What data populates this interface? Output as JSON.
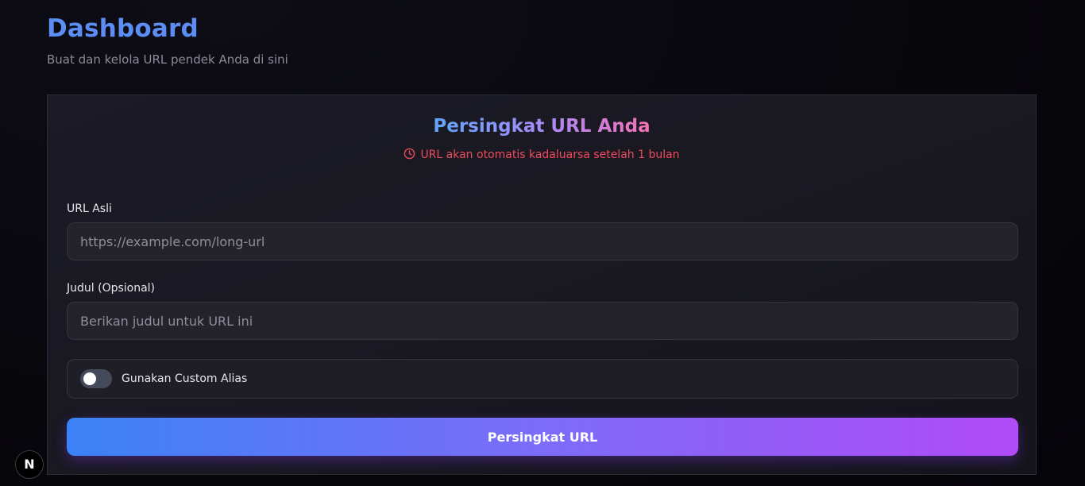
{
  "header": {
    "title": "Dashboard",
    "subtitle": "Buat dan kelola URL pendek Anda di sini"
  },
  "card": {
    "title": "Persingkat URL Anda",
    "expiry_notice": "URL akan otomatis kadaluarsa setelah 1 bulan",
    "expiry_icon": "clock-icon"
  },
  "form": {
    "original_url": {
      "label": "URL Asli",
      "value": "",
      "placeholder": "https://example.com/long-url"
    },
    "title": {
      "label": "Judul (Opsional)",
      "value": "",
      "placeholder": "Berikan judul untuk URL ini"
    },
    "custom_alias": {
      "label": "Gunakan Custom Alias",
      "enabled": false
    },
    "submit_label": "Persingkat URL"
  },
  "dev_badge": {
    "label": "N"
  },
  "colors": {
    "title": "#5b8df5",
    "expiry": "#ef4b5c",
    "gradient_start": "#3b82f6",
    "gradient_end": "#b04bf7"
  }
}
